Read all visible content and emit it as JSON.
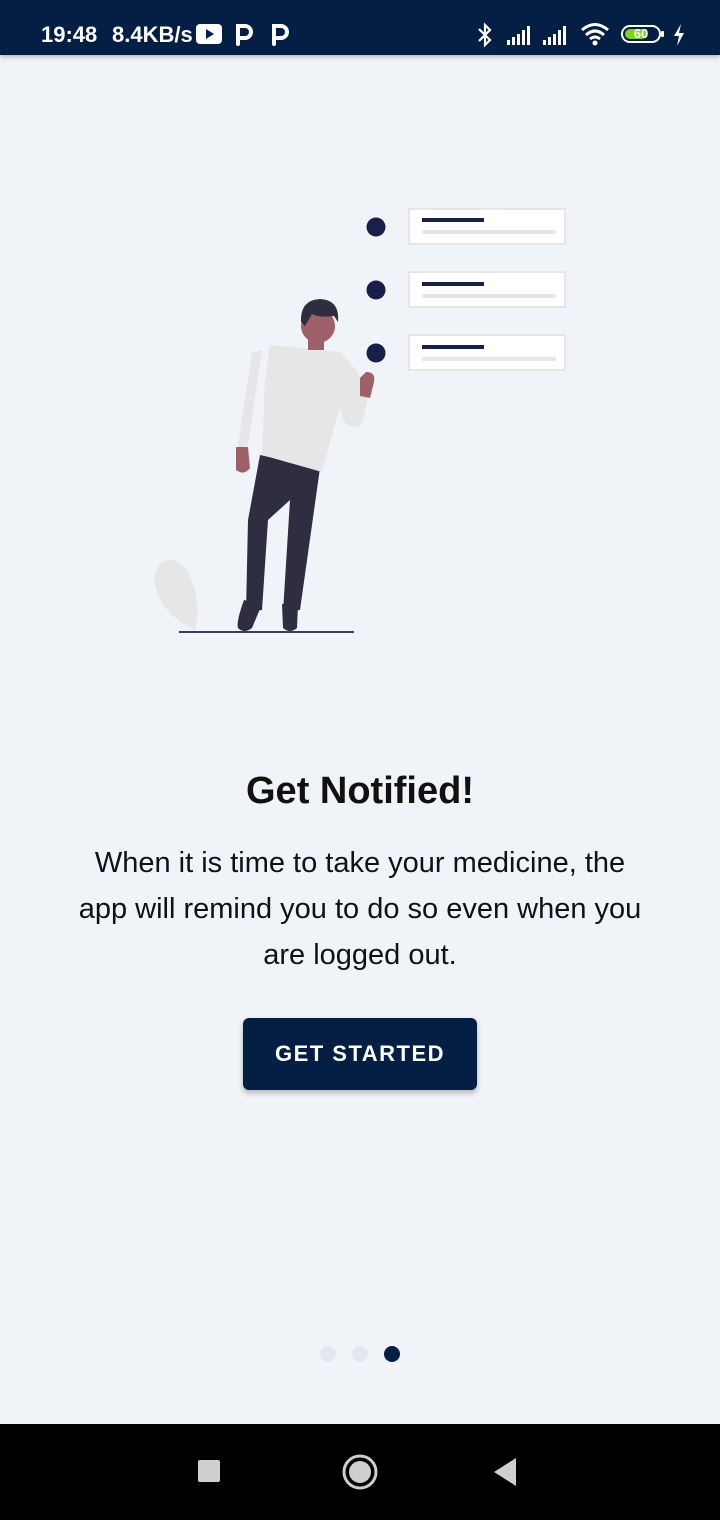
{
  "status_bar": {
    "time": "19:48",
    "speed": "8.4KB/s",
    "battery": "60",
    "icons": [
      "youtube-icon",
      "parking-icon",
      "parking-icon",
      "bluetooth-icon",
      "signal-icon",
      "signal-icon",
      "wifi-icon",
      "battery-icon",
      "charging-icon"
    ]
  },
  "onboarding": {
    "title": "Get Notified!",
    "description": "When it is time to take your medicine, the app will remind you to do so even when you are logged out.",
    "cta_label": "GET STARTED",
    "page_count": 3,
    "active_page": 3
  },
  "colors": {
    "primary": "#041e44",
    "background": "#f0f3f7",
    "dot_inactive": "#e3e7ee"
  },
  "navbar": {
    "icons": [
      "recents-icon",
      "home-icon",
      "back-icon"
    ]
  }
}
